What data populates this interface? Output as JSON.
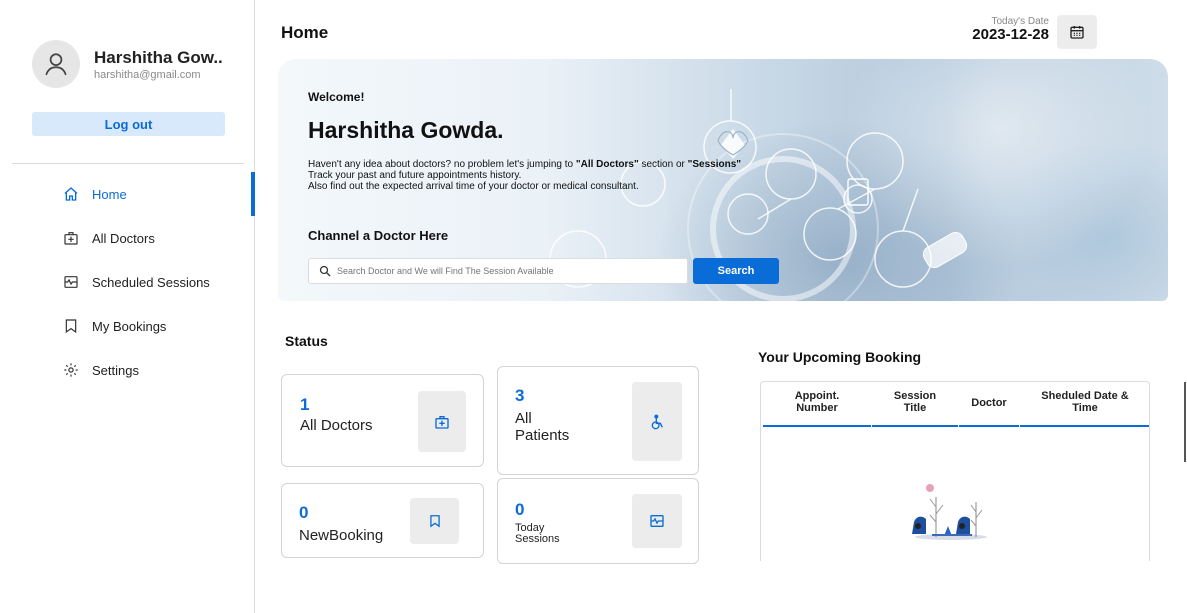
{
  "profile": {
    "name": "Harshitha Gow..",
    "email": "harshitha@gmail.com",
    "logout_label": "Log out"
  },
  "nav": {
    "items": [
      {
        "label": "Home",
        "icon": "home-icon",
        "active": true
      },
      {
        "label": "All Doctors",
        "icon": "doctor-bag-icon",
        "active": false
      },
      {
        "label": "Scheduled Sessions",
        "icon": "sessions-icon",
        "active": false
      },
      {
        "label": "My Bookings",
        "icon": "bookmark-icon",
        "active": false
      },
      {
        "label": "Settings",
        "icon": "gear-icon",
        "active": false
      }
    ]
  },
  "header": {
    "title": "Home",
    "date_label": "Today's Date",
    "date_value": "2023-12-28"
  },
  "banner": {
    "welcome": "Welcome!",
    "name": "Harshitha Gowda.",
    "line1_a": "Haven't any idea about doctors? no problem let's jumping to ",
    "line1_b": "\"All Doctors\"",
    "line1_c": " section or ",
    "line1_d": "\"Sessions\"",
    "line2": "Track your past and future appointments history.",
    "line3": "Also find out the expected arrival time of your doctor or medical consultant.",
    "channel_title": "Channel a Doctor Here",
    "search_placeholder": "Search Doctor and We will Find The Session Available",
    "search_button": "Search"
  },
  "status": {
    "title": "Status",
    "cards": [
      {
        "value": "1",
        "label": "All Doctors",
        "icon": "doctor-bag-icon"
      },
      {
        "value": "3",
        "label": "All\nPatients",
        "icon": "wheelchair-icon"
      },
      {
        "value": "0",
        "label": "NewBooking",
        "icon": "bookmark-icon"
      },
      {
        "value": "0",
        "label": "Today\nSessions",
        "icon": "sessions-icon"
      }
    ]
  },
  "upcoming": {
    "title": "Your Upcoming Booking",
    "columns": [
      "Appoint.\nNumber",
      "Session\nTitle",
      "Doctor",
      "Sheduled Date &\nTime"
    ]
  },
  "colors": {
    "accent": "#0a6cd6",
    "accent_light": "#d8e9fb"
  }
}
